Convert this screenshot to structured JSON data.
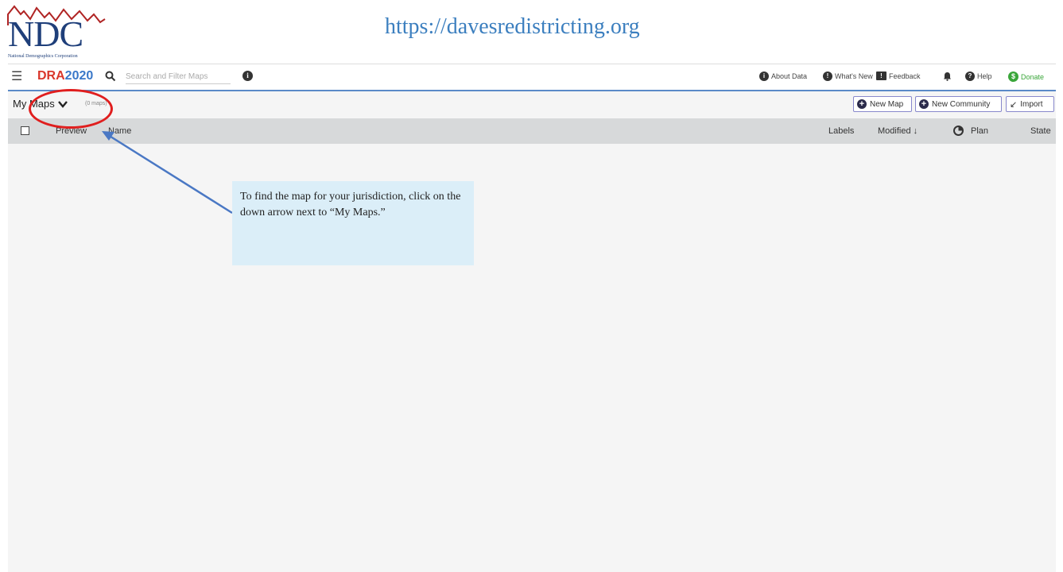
{
  "slide": {
    "logo_text": "NDC",
    "logo_subtext": "National Demographics Corporation",
    "url": "https://davesredistricting.org"
  },
  "topbar": {
    "brand_left": "DRA",
    "brand_right": "2020",
    "search_placeholder": "Search and Filter Maps",
    "nav": {
      "about_data": "About Data",
      "whats_new": "What's New",
      "feedback": "Feedback",
      "help": "Help",
      "donate": "Donate"
    }
  },
  "maps_bar": {
    "title": "My Maps",
    "count": "(0 maps)",
    "buttons": {
      "new_map": "New Map",
      "new_community": "New Community",
      "import": "Import"
    }
  },
  "table": {
    "columns": {
      "preview": "Preview",
      "name": "Name",
      "labels": "Labels",
      "modified": "Modified ↓",
      "plan": "Plan",
      "state": "State"
    }
  },
  "annotation": {
    "callout_text": "To find the map for your jurisdiction, click on the down arrow next to “My Maps.”"
  },
  "colors": {
    "annotation_circle": "#e01e1e",
    "annotation_arrow": "#4a78c4",
    "callout_bg": "#dbeef8",
    "brand_red": "#d9372b",
    "brand_blue": "#3a78c9",
    "donate_green": "#3aa63a"
  },
  "icons": {
    "menu": "hamburger-menu-icon",
    "search": "search-icon",
    "info": "info-icon",
    "bell": "bell-icon",
    "chevron": "chevron-down-icon",
    "plus": "plus-circle-icon",
    "import": "import-arrow-icon"
  }
}
